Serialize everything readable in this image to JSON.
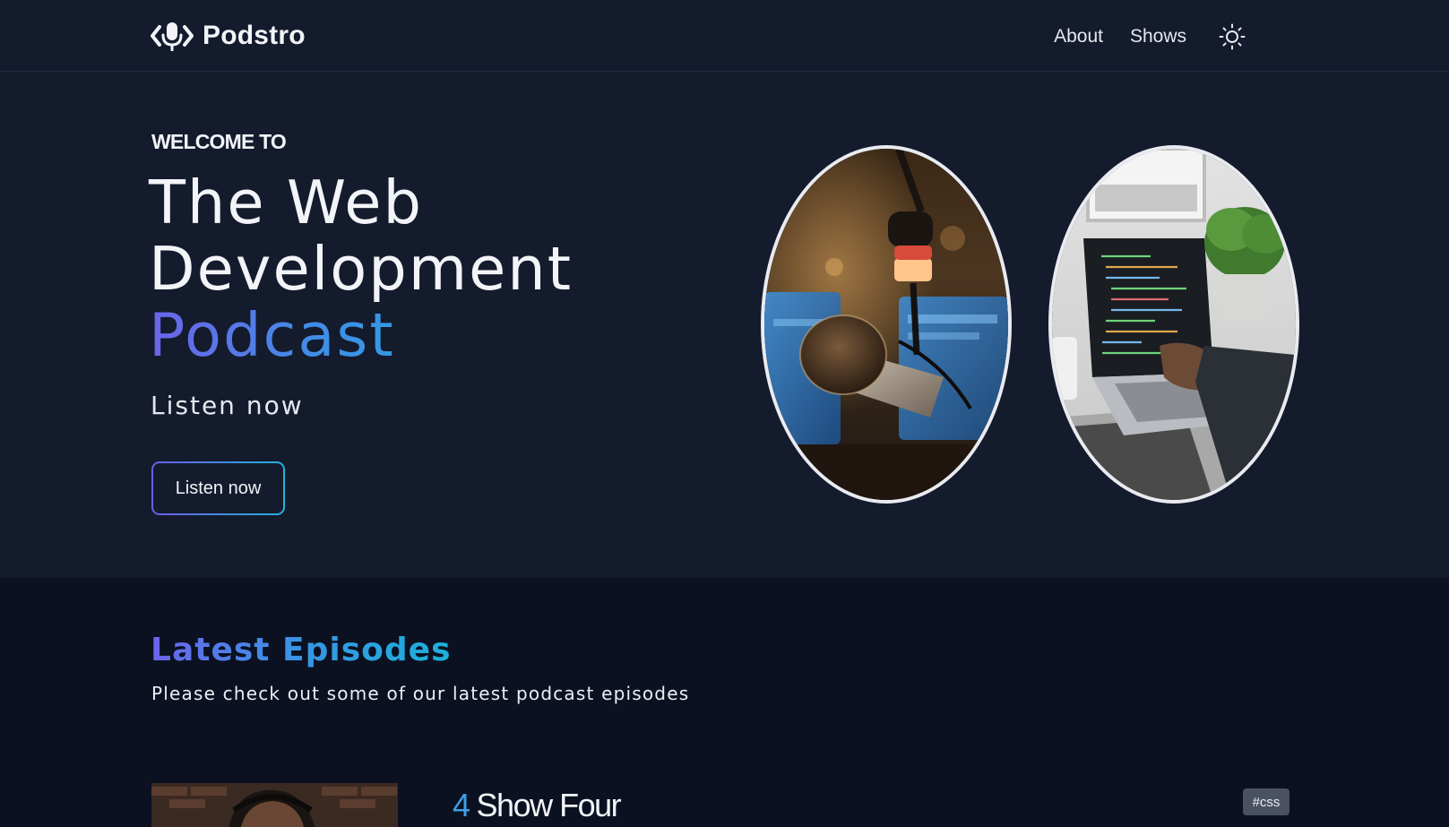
{
  "brand": {
    "name": "Podstro",
    "logo_icon": "code-microphone-icon"
  },
  "nav": {
    "items": [
      {
        "label": "About"
      },
      {
        "label": "Shows"
      }
    ],
    "theme_icon": "sun-icon"
  },
  "hero": {
    "eyebrow": "WELCOME TO",
    "title_line1": "The Web",
    "title_line2": "Development",
    "title_line3": "Podcast",
    "subtitle": "Listen now",
    "cta_label": "Listen now",
    "images": [
      "microphone-studio-photo",
      "laptop-coding-photo"
    ]
  },
  "latest": {
    "title": "Latest Episodes",
    "subtitle": "Please check out some of our latest podcast episodes",
    "episodes": [
      {
        "number": "4",
        "title": "Show Four",
        "tag": "#css"
      }
    ]
  },
  "colors": {
    "header_bg": "#141b2d",
    "hero_bg": "#141b2d",
    "section_bg": "#0b1121",
    "gradient_start": "#6d63e9",
    "gradient_end": "#1bb2d9",
    "episode_number": "#3d9ee8",
    "tag_bg": "#4a5262"
  }
}
